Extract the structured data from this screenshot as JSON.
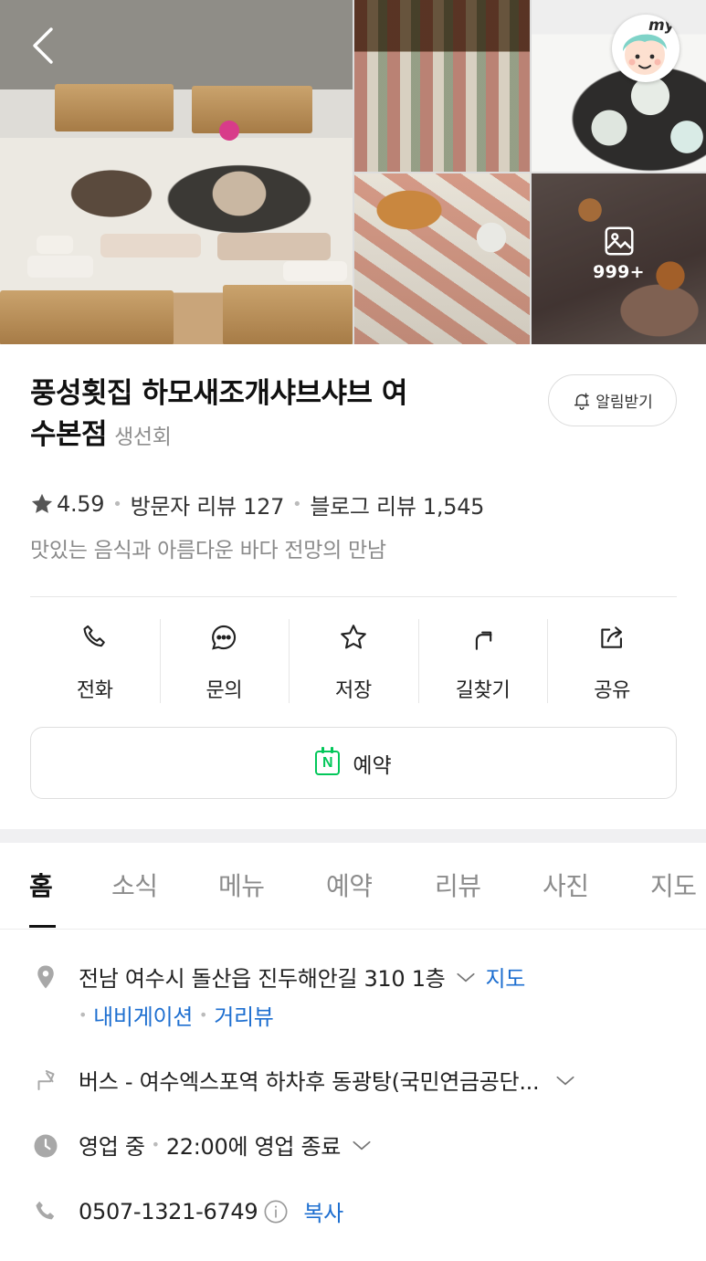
{
  "gallery": {
    "photo_count": "999+"
  },
  "header": {
    "my_label": "my"
  },
  "place": {
    "name_line1": "풍성횟집 하모새조개샤브샤브 여",
    "name_line2": "수본점",
    "category": "생선회",
    "alarm_label": "알림받기",
    "rating": "4.59",
    "visitor_reviews": "방문자 리뷰 127",
    "blog_reviews": "블로그 리뷰 1,545",
    "description": "맛있는 음식과 아름다운 바다 전망의 만남"
  },
  "actions": [
    {
      "label": "전화",
      "icon": "phone-icon"
    },
    {
      "label": "문의",
      "icon": "chat-icon"
    },
    {
      "label": "저장",
      "icon": "star-icon"
    },
    {
      "label": "길찾기",
      "icon": "route-icon"
    },
    {
      "label": "공유",
      "icon": "share-icon"
    }
  ],
  "reserve": {
    "badge": "N",
    "label": "예약"
  },
  "tabs": [
    "홈",
    "소식",
    "메뉴",
    "예약",
    "리뷰",
    "사진",
    "지도"
  ],
  "active_tab": "홈",
  "info": {
    "address": "전남 여수시 돌산읍 진두해안길 310 1층",
    "map_link": "지도",
    "navigation_link": "내비게이션",
    "street_view_link": "거리뷰",
    "directions": "버스 - 여수엑스포역 하차후 동광탕(국민연금공단...",
    "hours_status": "영업 중",
    "hours_detail": "22:00에 영업 종료",
    "phone": "0507-1321-6749",
    "copy_label": "복사"
  },
  "colors": {
    "link": "#1e6fd0",
    "naver_green": "#03c75a",
    "icon_gray": "#a8a8a8"
  }
}
